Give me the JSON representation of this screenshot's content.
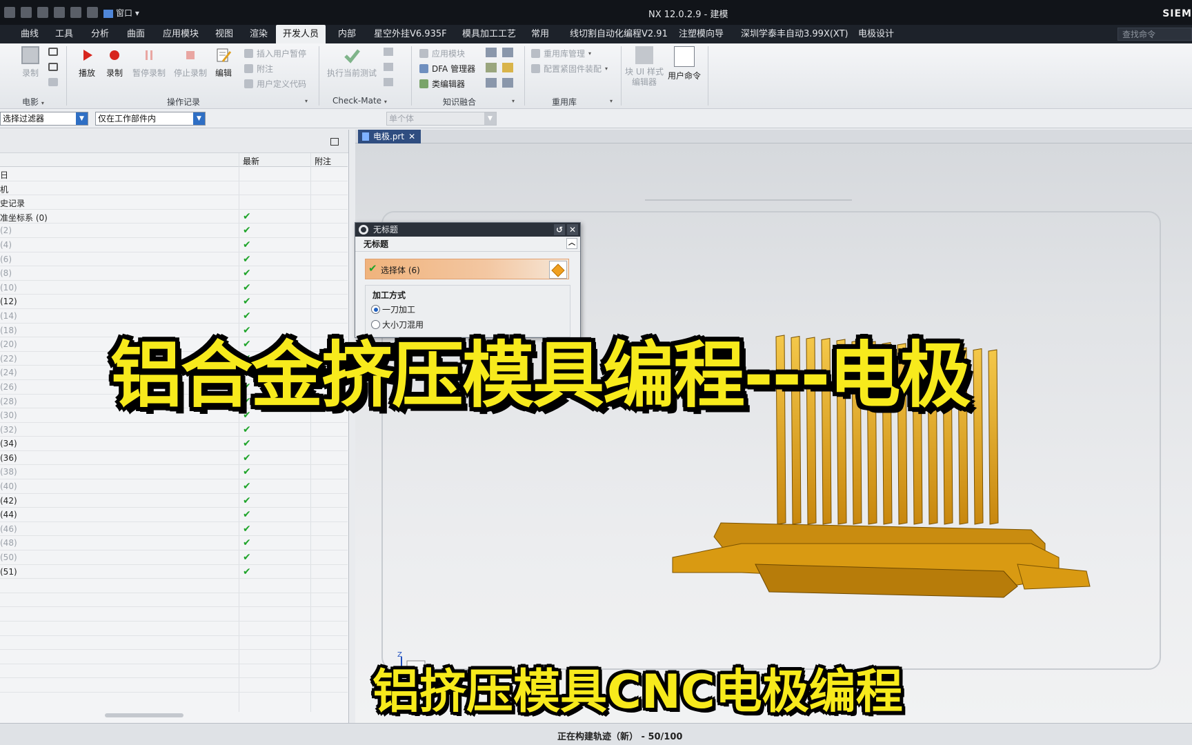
{
  "titlebar": {
    "window_menu": "窗口",
    "title": "NX 12.0.2.9 - 建模",
    "brand": "SIEM"
  },
  "menubar": {
    "tabs": [
      "曲线",
      "工具",
      "分析",
      "曲面",
      "应用模块",
      "视图",
      "渲染",
      "开发人员",
      "内部",
      "星空外挂V6.935F",
      "模具加工工艺",
      "常用",
      "线切割自动化编程V2.91",
      "注塑模向导",
      "深圳学泰丰自动3.99X(XT)",
      "电极设计"
    ],
    "active_tab": "开发人员",
    "search_placeholder": "查找命令"
  },
  "ribbon": {
    "movie": {
      "record": "录制",
      "group": "电影"
    },
    "journal": {
      "play": "播放",
      "record": "录制",
      "pause": "暂停录制",
      "stop": "停止录制",
      "edit": "编辑",
      "insert_user_pause": "插入用户暂停",
      "comment": "附注",
      "user_code": "用户定义代码",
      "group": "操作记录"
    },
    "checkmate": {
      "run_test": "执行当前测试",
      "group": "Check-Mate"
    },
    "knowledge": {
      "app_module": "应用模块",
      "dfa_manager": "DFA 管理器",
      "class_editor": "类编辑器",
      "group": "知识融合"
    },
    "reuse": {
      "manage": "重用库管理",
      "fastener": "配置紧固件装配",
      "group": "重用库"
    },
    "ui": {
      "block_ui": "块 UI 样式编辑器",
      "user_command": "用户命令"
    }
  },
  "selection_bar": {
    "filter": "选择过滤器",
    "scope": "仅在工作部件内",
    "body_scope": "单个体"
  },
  "navigator": {
    "columns": [
      "最新",
      "附注"
    ],
    "rows": [
      {
        "name": "日",
        "dim": false,
        "latest": false
      },
      {
        "name": "机",
        "dim": false,
        "latest": false
      },
      {
        "name": "史记录",
        "dim": false,
        "latest": false
      },
      {
        "name": "准坐标系 (0)",
        "dim": false,
        "latest": true
      },
      {
        "name": "(2)",
        "dim": true,
        "latest": true
      },
      {
        "name": "(4)",
        "dim": true,
        "latest": true
      },
      {
        "name": "(6)",
        "dim": true,
        "latest": true
      },
      {
        "name": "(8)",
        "dim": true,
        "latest": true
      },
      {
        "name": "(10)",
        "dim": true,
        "latest": true
      },
      {
        "name": "(12)",
        "dim": false,
        "latest": true
      },
      {
        "name": "(14)",
        "dim": true,
        "latest": true
      },
      {
        "name": "(18)",
        "dim": true,
        "latest": true
      },
      {
        "name": "(20)",
        "dim": true,
        "latest": true
      },
      {
        "name": "(22)",
        "dim": true,
        "latest": true
      },
      {
        "name": "(24)",
        "dim": true,
        "latest": true
      },
      {
        "name": "(26)",
        "dim": true,
        "latest": true
      },
      {
        "name": "(28)",
        "dim": true,
        "latest": true
      },
      {
        "name": "(30)",
        "dim": true,
        "latest": true
      },
      {
        "name": "(32)",
        "dim": true,
        "latest": true
      },
      {
        "name": "(34)",
        "dim": false,
        "latest": true
      },
      {
        "name": "(36)",
        "dim": false,
        "latest": true
      },
      {
        "name": "(38)",
        "dim": true,
        "latest": true
      },
      {
        "name": "(40)",
        "dim": true,
        "latest": true
      },
      {
        "name": "(42)",
        "dim": false,
        "latest": true
      },
      {
        "name": "(44)",
        "dim": false,
        "latest": true
      },
      {
        "name": "(46)",
        "dim": true,
        "latest": true
      },
      {
        "name": "(48)",
        "dim": true,
        "latest": true
      },
      {
        "name": "(50)",
        "dim": true,
        "latest": true
      },
      {
        "name": "(51)",
        "dim": false,
        "latest": true
      }
    ]
  },
  "graphics": {
    "file_tab": "电极.prt"
  },
  "dialog": {
    "title": "无标题",
    "section": "无标题",
    "select_body": "选择体 (6)",
    "method_group": "加工方式",
    "option_1": "一刀加工",
    "option_2": "大小刀混用",
    "selected_option": 1
  },
  "overlay": {
    "title": "铝合金挤压模具编程---电极",
    "subtitle": "铝挤压模具CNC电极编程"
  },
  "status": {
    "message": "正在构建轨迹（新） - 50/100"
  },
  "colors": {
    "accent": "#f7ea1c",
    "model": "#d99a12",
    "check": "#1fa42a"
  }
}
